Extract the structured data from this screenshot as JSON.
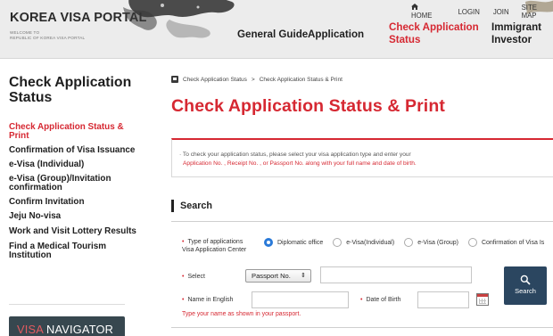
{
  "brand": {
    "name": "KOREA VISA PORTAL",
    "tagline_1": "WELCOME TO",
    "tagline_2": "REPUBLIC OF KOREA VISA PORTAL"
  },
  "utility_nav": {
    "home": "HOME",
    "login": "LOGIN",
    "join": "JOIN",
    "sitemap": "SITE MAP"
  },
  "main_nav": [
    {
      "label": "General Guide",
      "active": false
    },
    {
      "label": "Application",
      "active": false
    },
    {
      "label": "Check Application Status",
      "line1": "Check Application",
      "line2": "Status",
      "active": true
    },
    {
      "label": "Immigrant Investor",
      "line1": "Immigrant",
      "line2": "Investor",
      "active": false
    }
  ],
  "sidebar": {
    "title": "Check Application Status",
    "items": [
      {
        "label": "Check Application Status & Print",
        "active": true
      },
      {
        "label": "Confirmation of Visa Issuance",
        "active": false
      },
      {
        "label": "e-Visa (Individual)",
        "active": false
      },
      {
        "label": "e-Visa (Group)/Invitation confirmation",
        "active": false
      },
      {
        "label": "Confirm Invitation",
        "active": false
      },
      {
        "label": "Jeju No-visa",
        "active": false
      },
      {
        "label": "Work and Visit Lottery Results",
        "active": false
      },
      {
        "label": "Find a Medical Tourism Institution",
        "active": false
      }
    ],
    "banner": {
      "word1": "VISA",
      "word2": "NAVIGATOR"
    }
  },
  "breadcrumb": {
    "items": [
      "Check Application Status",
      "Check Application Status & Print"
    ],
    "separator": ">"
  },
  "page_title": "Check Application Status & Print",
  "notice": {
    "line1": "· To check your application status, please select your visa application type and enter your",
    "line2": "Application No. , Receipt No. , or Passport No. along with your full name and date of birth."
  },
  "search": {
    "section_label": "Search",
    "type_label_1": "Type of applications",
    "type_label_2": "Visa Application Center",
    "application_types": [
      {
        "label": "Diplomatic office",
        "selected": true
      },
      {
        "label": "e-Visa(Individual)",
        "selected": false
      },
      {
        "label": "e-Visa (Group)",
        "selected": false
      },
      {
        "label": "Confirmation of Visa Is",
        "selected": false
      }
    ],
    "select_label": "Select",
    "select_value": "Passport No.",
    "name_label": "Name in English",
    "dob_label": "Date of Birth",
    "name_hint": "Type your name as shown in your passport.",
    "button_label": "Search"
  },
  "colors": {
    "accent_red": "#d62832",
    "search_button": "#2b4660",
    "radio_selected": "#2a7ad8",
    "banner_bg": "#37474f"
  }
}
